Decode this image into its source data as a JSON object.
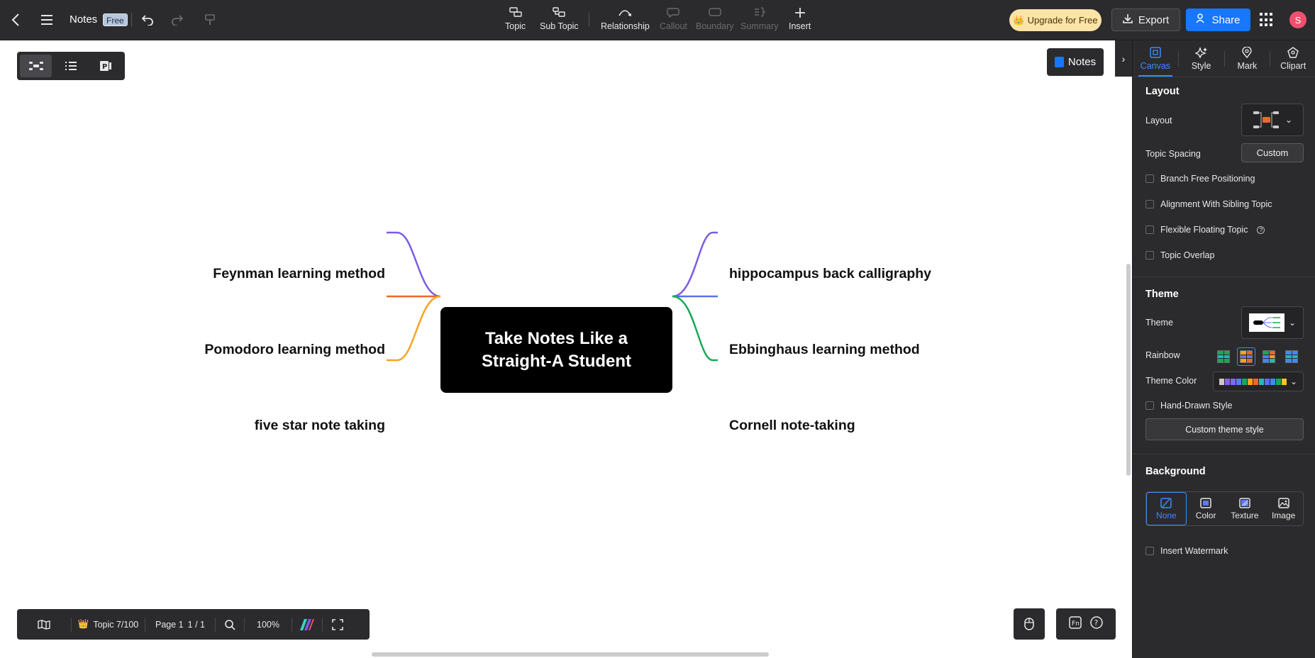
{
  "header": {
    "doc_title": "Notes",
    "plan_badge": "Free",
    "tools": [
      {
        "label": "Topic",
        "icon": "topic-icon",
        "enabled": true
      },
      {
        "label": "Sub Topic",
        "icon": "subtopic-icon",
        "enabled": true
      },
      {
        "label": "Relationship",
        "icon": "relationship-icon",
        "enabled": true
      },
      {
        "label": "Callout",
        "icon": "callout-icon",
        "enabled": false
      },
      {
        "label": "Boundary",
        "icon": "boundary-icon",
        "enabled": false
      },
      {
        "label": "Summary",
        "icon": "summary-icon",
        "enabled": false
      },
      {
        "label": "Insert",
        "icon": "plus-icon",
        "enabled": true
      }
    ],
    "upgrade_label": "Upgrade for Free",
    "export_label": "Export",
    "share_label": "Share",
    "avatar_initial": "S"
  },
  "canvas": {
    "notes_button_label": "Notes",
    "central_topic": "Take Notes Like a Straight-A Student",
    "left_topics": [
      {
        "text": "Feynman learning method",
        "color": "#7b5ce6"
      },
      {
        "text": "Pomodoro learning method",
        "color": "#f0652d"
      },
      {
        "text": "five star note taking",
        "color": "#f7a51f"
      }
    ],
    "right_topics": [
      {
        "text": "hippocampus back calligraphy",
        "color": "#7b5ce6"
      },
      {
        "text": "Ebbinghaus learning method",
        "color": "#5b6ef0"
      },
      {
        "text": "Cornell note-taking",
        "color": "#19a85a"
      }
    ]
  },
  "statusbar": {
    "topic_count": "Topic 7/100",
    "page_label": "Page 1",
    "page_count": "1 / 1",
    "zoom": "100%"
  },
  "panel": {
    "tabs": [
      {
        "label": "Canvas",
        "active": true
      },
      {
        "label": "Style",
        "active": false
      },
      {
        "label": "Mark",
        "active": false
      },
      {
        "label": "Clipart",
        "active": false
      }
    ],
    "layout_section": {
      "title": "Layout",
      "layout_label": "Layout",
      "spacing_label": "Topic Spacing",
      "spacing_button": "Custom",
      "options": [
        {
          "label": "Branch Free Positioning",
          "checked": false
        },
        {
          "label": "Alignment With Sibling Topic",
          "checked": false
        },
        {
          "label": "Flexible Floating Topic",
          "checked": false
        },
        {
          "label": "Topic Overlap",
          "checked": false
        }
      ]
    },
    "theme_section": {
      "title": "Theme",
      "theme_label": "Theme",
      "rainbow_label": "Rainbow",
      "theme_color_label": "Theme Color",
      "theme_colors": [
        "#c9c9c9",
        "#8a5cf6",
        "#7b6cf0",
        "#5b7bf0",
        "#19a85a",
        "#f7a51f",
        "#f0652d",
        "#2bb5b5",
        "#5b6ef0",
        "#3b8bff",
        "#19a85a",
        "#f7c51f"
      ],
      "hand_drawn_label": "Hand-Drawn Style",
      "custom_theme_button": "Custom theme style"
    },
    "background_section": {
      "title": "Background",
      "options": [
        {
          "label": "None",
          "active": true
        },
        {
          "label": "Color",
          "active": false
        },
        {
          "label": "Texture",
          "active": false
        },
        {
          "label": "Image",
          "active": false
        }
      ],
      "watermark_label": "Insert Watermark"
    }
  }
}
